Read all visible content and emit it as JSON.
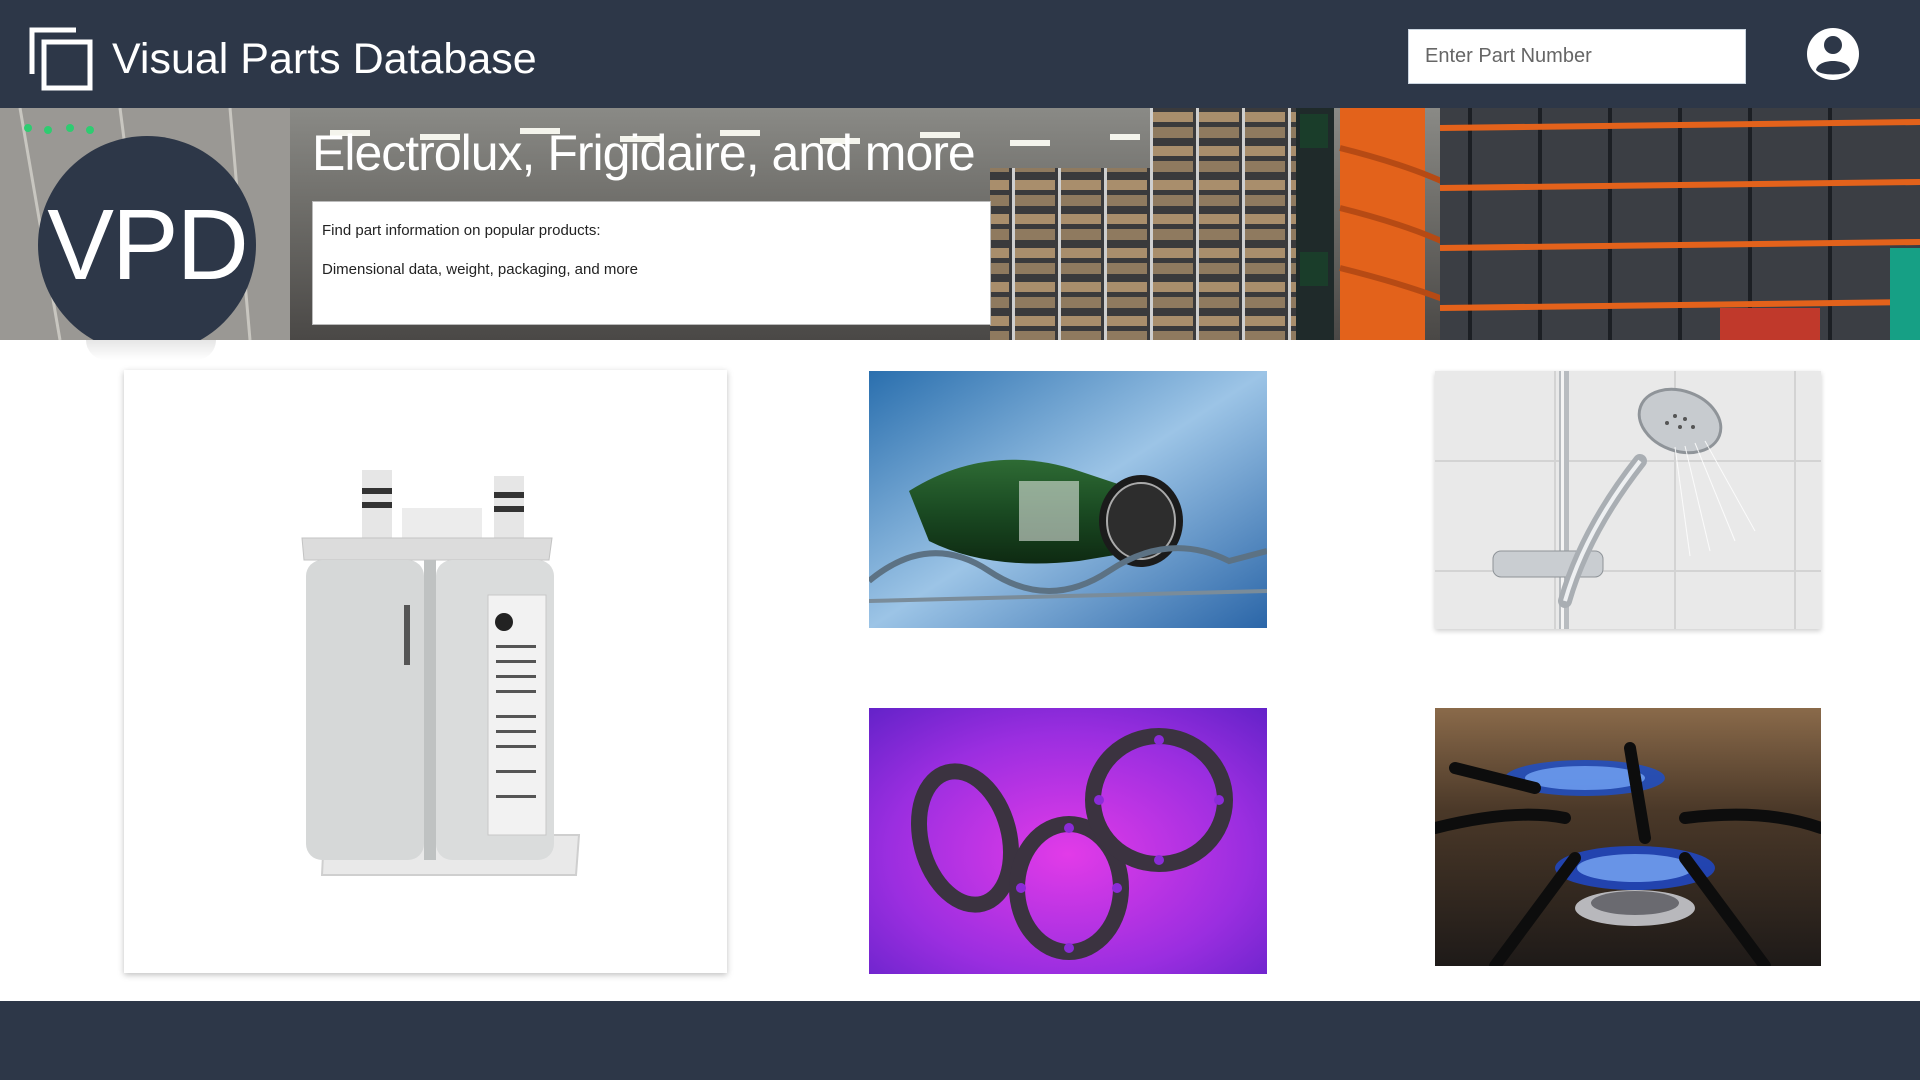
{
  "header": {
    "app_title": "Visual Parts Database",
    "logo_icon": "copy-icon",
    "search": {
      "placeholder": "Enter Part Number",
      "value": ""
    },
    "user_icon": "user-account-icon"
  },
  "hero": {
    "badge_text": "VPD",
    "title": "Electrolux, Frigidaire, and more",
    "description_lines": [
      "Find part information on popular products:",
      "Dimensional data, weight, packaging, and more"
    ]
  },
  "products": [
    {
      "id": "water-filter",
      "image": "water-filter-photo"
    },
    {
      "id": "bottle",
      "image": "bottle-in-fridge-rack-photo"
    },
    {
      "id": "shower-head",
      "image": "shower-head-photo"
    },
    {
      "id": "gaskets",
      "image": "rubber-gaskets-photo"
    },
    {
      "id": "gas-stove",
      "image": "gas-stove-burner-photo"
    }
  ],
  "colors": {
    "header_bg": "#2d3748",
    "footer_bg": "#2d3748",
    "accent_orange": "#e3621b"
  }
}
